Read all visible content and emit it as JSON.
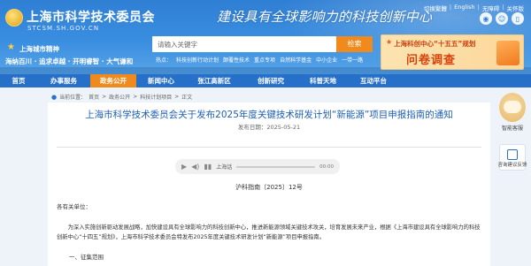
{
  "header": {
    "site_title": "上海市科学技术委员会",
    "site_url": "STCSM.SH.GOV.CN",
    "slogan": "建设具有全球影响力的科技创新中心",
    "top_links": [
      "切换繁體",
      "English",
      "无障碍",
      "关怀版"
    ],
    "spirit_title": "上海城市精神",
    "spirit_text": "海纳百川 · 追求卓越 · 开明睿智 · 大气谦和",
    "search_placeholder": "请输入关键字",
    "search_button": "检索",
    "hot_links": [
      "热点：",
      "科技创新行动计划",
      "颠覆性技术",
      "重点专项",
      "自然科学基金",
      "中小企业",
      "一带一路"
    ],
    "promo_title": "上海科创中心“十五五”规划",
    "promo_sub": "问卷调查"
  },
  "nav": {
    "items": [
      "首页",
      "办事服务",
      "政务公开",
      "新闻中心",
      "张江高新区",
      "创新研究",
      "科普天地",
      "互动平台"
    ]
  },
  "breadcrumb": [
    "当前位置：",
    "首页",
    ">",
    "政务公开",
    ">",
    "科技计划项目",
    ">",
    "正文"
  ],
  "article": {
    "title": "上海市科学技术委员会关于发布2025年度关键技术研发计划“新能源”项目申报指南的通知",
    "date": "发布日期：2025-05-21",
    "audio_text": "上海话",
    "audio_time": "00:00",
    "doc_no": "沪科指南〔2025〕12号",
    "salutation": "各有关单位：",
    "paragraph": "为深入实施创新驱动发展战略，加快建设具有全球影响力的科技创新中心，推进新能源领域关键技术攻关，培育发展未来产业，根据《上海市建设具有全球影响力的科技创新中心“十四五”规划》，上海市科学技术委员会特发布2025年度关键技术研发计划“新能源”项目申报指南。",
    "section": "一、征集范围"
  },
  "side": {
    "assistant_label": "智能客服",
    "feedback_label": "咨询建议反馈"
  }
}
